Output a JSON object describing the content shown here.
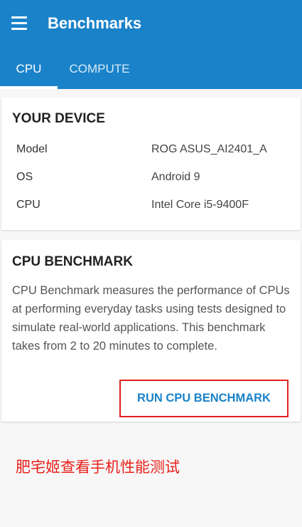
{
  "app_bar": {
    "title": "Benchmarks",
    "menu_icon": "hamburger-menu-icon"
  },
  "tabs": [
    {
      "label": "CPU",
      "selected": true
    },
    {
      "label": "COMPUTE",
      "selected": false
    }
  ],
  "device_card": {
    "title": "YOUR DEVICE",
    "rows": [
      {
        "key": "Model",
        "value": "ROG ASUS_AI2401_A"
      },
      {
        "key": "OS",
        "value": "Android 9"
      },
      {
        "key": "CPU",
        "value": "Intel Core i5-9400F"
      }
    ]
  },
  "benchmark_card": {
    "title": "CPU BENCHMARK",
    "description": "CPU Benchmark measures the performance of CPUs at performing everyday tasks using tests designed to simulate real-world applications. This benchmark takes from 2 to 20 minutes to complete.",
    "run_label": "RUN CPU BENCHMARK"
  },
  "annotation": {
    "caption": "肥宅姬查看手机性能测试"
  },
  "colors": {
    "primary": "#1a82c9",
    "annotation_red": "#e02020"
  }
}
